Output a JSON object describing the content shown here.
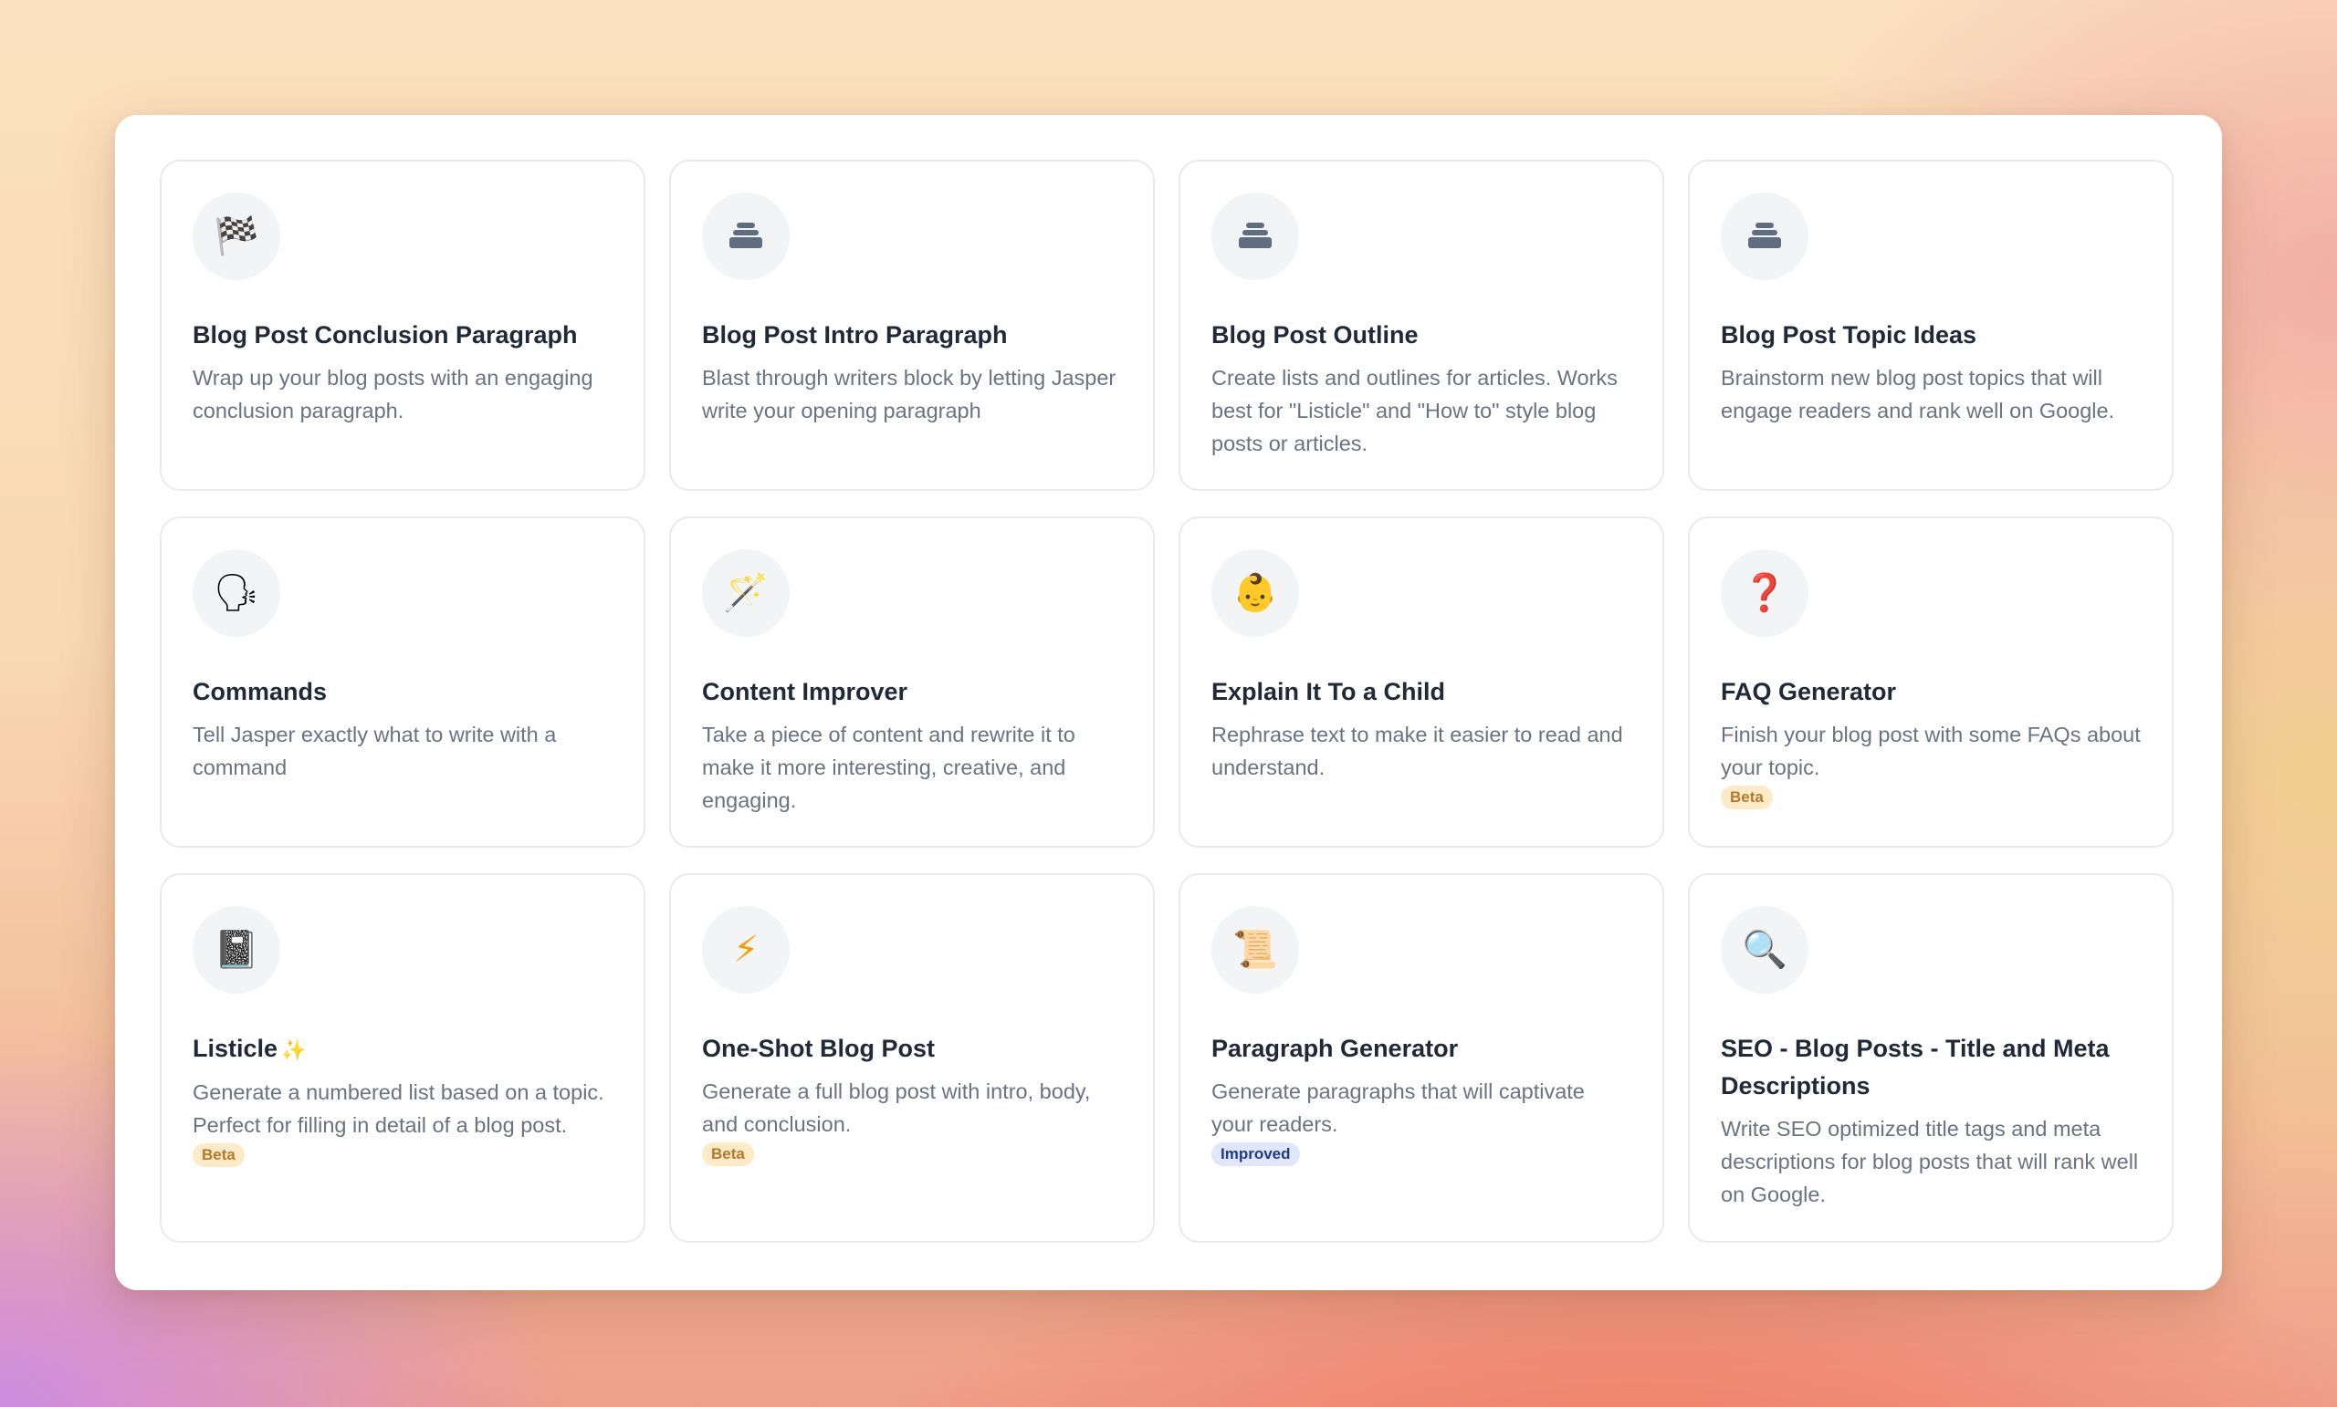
{
  "cards": [
    {
      "icon": "🏁",
      "icon_name": "checkered-flag-icon",
      "title": "Blog Post Conclusion Paragraph",
      "desc": "Wrap up your blog posts with an engaging conclusion paragraph.",
      "badge": ""
    },
    {
      "icon": "",
      "icon_name": "inbox-tray-icon",
      "title": "Blog Post Intro Paragraph",
      "desc": "Blast through writers block by letting Jasper write your opening paragraph",
      "badge": ""
    },
    {
      "icon": "",
      "icon_name": "inbox-tray-icon",
      "title": "Blog Post Outline",
      "desc": "Create lists and outlines for articles. Works best for \"Listicle\" and \"How to\" style blog posts or articles.",
      "badge": ""
    },
    {
      "icon": "",
      "icon_name": "inbox-tray-icon",
      "title": "Blog Post Topic Ideas",
      "desc": "Brainstorm new blog post topics that will engage readers and rank well on Google.",
      "badge": ""
    },
    {
      "icon": "🗣",
      "icon_name": "speaking-head-icon",
      "title": "Commands",
      "desc": "Tell Jasper exactly what to write with a command",
      "badge": ""
    },
    {
      "icon": "🪄",
      "icon_name": "magic-wand-icon",
      "title": "Content Improver",
      "desc": "Take a piece of content and rewrite it to make it more interesting, creative, and engaging.",
      "badge": ""
    },
    {
      "icon": "👶",
      "icon_name": "baby-face-icon",
      "title": "Explain It To a Child",
      "desc": "Rephrase text to make it easier to read and understand.",
      "badge": ""
    },
    {
      "icon": "❓",
      "icon_name": "question-mark-icon",
      "title": "FAQ Generator",
      "desc": "Finish your blog post with some FAQs about your topic.",
      "badge": "Beta"
    },
    {
      "icon": "📓",
      "icon_name": "notebook-icon",
      "title": "Listicle",
      "title_extra": "✨",
      "desc": "Generate a numbered list based on a topic. Perfect for filling in detail of a blog post.",
      "badge": "Beta"
    },
    {
      "icon": "⚡",
      "icon_name": "lightning-bolt-icon",
      "title": "One-Shot Blog Post",
      "desc": "Generate a full blog post with intro, body, and conclusion.",
      "badge": "Beta"
    },
    {
      "icon": "📜",
      "icon_name": "scroll-icon",
      "title": "Paragraph Generator",
      "desc": "Generate paragraphs that will captivate your readers.",
      "badge": "Improved"
    },
    {
      "icon": "🔍",
      "icon_name": "magnifying-glass-icon",
      "title": "SEO - Blog Posts - Title and Meta Descriptions",
      "desc": "Write SEO optimized title tags and meta descriptions for blog posts that will rank well on Google.",
      "badge": ""
    }
  ],
  "colors": {
    "title": "#1f2937",
    "desc": "#6b7280",
    "beta_bg": "#fdebc8",
    "beta_text": "#b7772a",
    "improved_bg": "#e1e7fb",
    "improved_text": "#1e3a8a"
  }
}
